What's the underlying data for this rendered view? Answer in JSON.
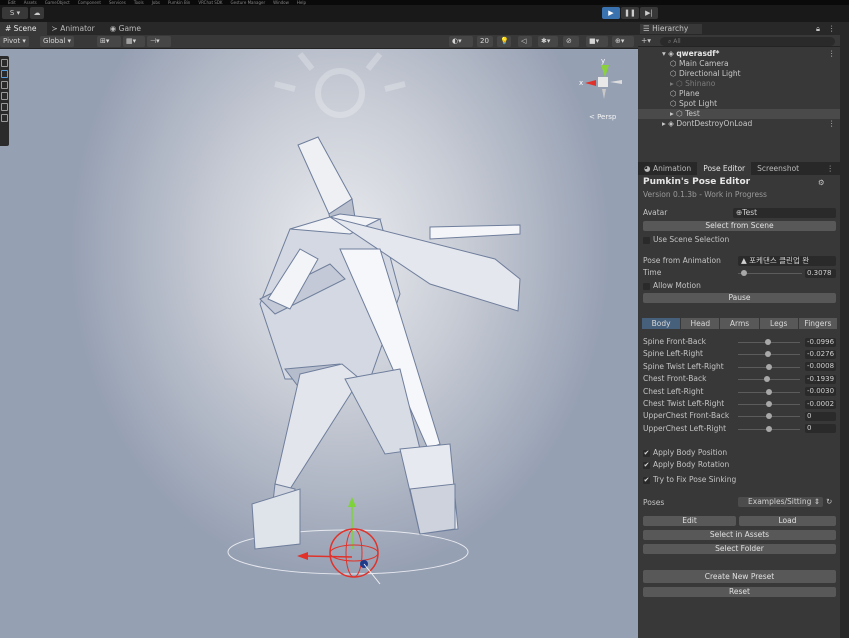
{
  "menubar": [
    "Edit",
    "Assets",
    "GameObject",
    "Component",
    "Services",
    "Tools",
    "Jobs",
    "Pumkin Bin",
    "VRChat SDK",
    "Gesture Manager",
    "Window",
    "Help"
  ],
  "toolbar": {
    "account_label": "S ▾"
  },
  "scene_tabs": [
    {
      "label": "Scene",
      "active": true
    },
    {
      "label": "Animator",
      "active": false
    },
    {
      "label": "Game",
      "active": false
    }
  ],
  "scene_toolbar": {
    "pivot": "Pivot ▾",
    "global": "Global ▾",
    "grid_count": "20",
    "persp": "< Persp"
  },
  "hierarchy": {
    "title": "Hierarchy",
    "search_placeholder": "All",
    "scene_name": "qwerasdf*",
    "items": [
      {
        "label": "Main Camera",
        "state": "normal"
      },
      {
        "label": "Directional Light",
        "state": "normal"
      },
      {
        "label": "Shinano",
        "state": "disabled"
      },
      {
        "label": "Plane",
        "state": "normal"
      },
      {
        "label": "Spot Light",
        "state": "normal"
      },
      {
        "label": "Test",
        "state": "selected"
      }
    ],
    "dont_destroy": "DontDestroyOnLoad"
  },
  "inspector": {
    "tabs": [
      {
        "label": "Animation",
        "active": false
      },
      {
        "label": "Pose Editor",
        "active": true
      },
      {
        "label": "Screenshot",
        "active": false
      }
    ],
    "title": "Pumkin's Pose Editor",
    "version": "Version 0.1.3b - Work in Progress",
    "avatar_label": "Avatar",
    "avatar_value": "Test",
    "select_from_scene": "Select from Scene",
    "use_scene_selection": "Use Scene Selection",
    "pose_from_animation_label": "Pose from Animation",
    "pose_from_animation_value": "포케댄스 클린업 완",
    "time_label": "Time",
    "time_value": "0.3078",
    "time_fraction": 0.05,
    "allow_motion": "Allow Motion",
    "pause": "Pause",
    "body_tabs": [
      {
        "label": "Body",
        "active": true
      },
      {
        "label": "Head",
        "active": false
      },
      {
        "label": "Arms",
        "active": false
      },
      {
        "label": "Legs",
        "active": false
      },
      {
        "label": "Fingers",
        "active": false
      }
    ],
    "sliders": [
      {
        "label": "Spine Front-Back",
        "value": "-0.0996",
        "fraction": 0.48
      },
      {
        "label": "Spine Left-Right",
        "value": "-0.0276",
        "fraction": 0.49
      },
      {
        "label": "Spine Twist Left-Right",
        "value": "-0.0008",
        "fraction": 0.5
      },
      {
        "label": "Chest Front-Back",
        "value": "-0.1939",
        "fraction": 0.46
      },
      {
        "label": "Chest Left-Right",
        "value": "-0.0030",
        "fraction": 0.5
      },
      {
        "label": "Chest Twist Left-Right",
        "value": "-0.0002",
        "fraction": 0.5
      },
      {
        "label": "UpperChest Front-Back",
        "value": "0",
        "fraction": 0.5
      },
      {
        "label": "UpperChest Left-Right",
        "value": "0",
        "fraction": 0.5
      }
    ],
    "apply_body_position": "Apply Body Position",
    "apply_body_rotation": "Apply Body Rotation",
    "fix_pose_sinking": "Try to Fix Pose Sinking",
    "poses_label": "Poses",
    "poses_value": "Examples/Sitting",
    "edit": "Edit",
    "load": "Load",
    "select_in_assets": "Select in Assets",
    "select_folder": "Select Folder",
    "create_new_preset": "Create New Preset",
    "reset": "Reset"
  },
  "colors": {
    "accent_blue": "#3a72b0",
    "panel": "#383838",
    "dark": "#282828",
    "tab_active": "#46607c"
  }
}
